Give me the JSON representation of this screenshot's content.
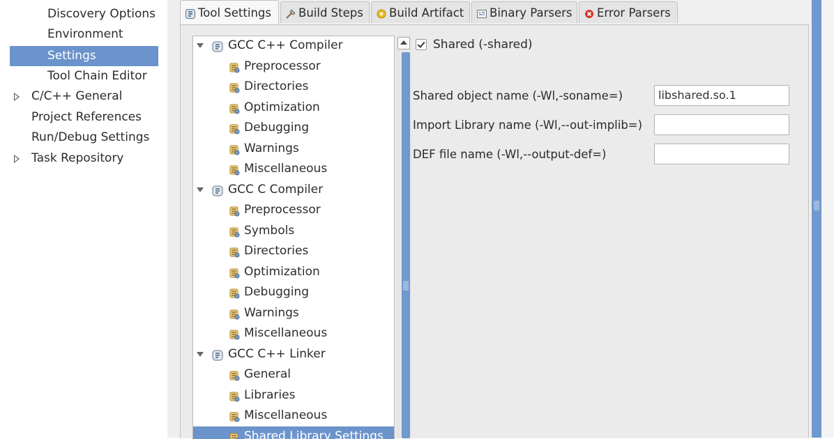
{
  "nav": {
    "items": [
      {
        "label": "Discovery Options",
        "level": 1,
        "selected": false,
        "expandable": false
      },
      {
        "label": "Environment",
        "level": 1,
        "selected": false,
        "expandable": false
      },
      {
        "label": "Settings",
        "level": 1,
        "selected": true,
        "expandable": false
      },
      {
        "label": "Tool Chain Editor",
        "level": 1,
        "selected": false,
        "expandable": false
      },
      {
        "label": "C/C++ General",
        "level": 0,
        "selected": false,
        "expandable": true
      },
      {
        "label": "Project References",
        "level": 0,
        "selected": false,
        "expandable": false
      },
      {
        "label": "Run/Debug Settings",
        "level": 0,
        "selected": false,
        "expandable": false
      },
      {
        "label": "Task Repository",
        "level": 0,
        "selected": false,
        "expandable": true
      }
    ]
  },
  "tabs": [
    {
      "label": "Tool Settings",
      "icon": "tool-settings-icon",
      "active": true
    },
    {
      "label": "Build Steps",
      "icon": "build-steps-icon",
      "active": false
    },
    {
      "label": "Build Artifact",
      "icon": "build-artifact-icon",
      "active": false
    },
    {
      "label": "Binary Parsers",
      "icon": "binary-parsers-icon",
      "active": false
    },
    {
      "label": "Error Parsers",
      "icon": "error-parsers-icon",
      "active": false
    }
  ],
  "tree": {
    "items": [
      {
        "label": "GCC C++ Compiler",
        "level": 0,
        "icon": "tool-icon",
        "expanded": true
      },
      {
        "label": "Preprocessor",
        "level": 1,
        "icon": "option-category-icon"
      },
      {
        "label": "Directories",
        "level": 1,
        "icon": "option-category-icon"
      },
      {
        "label": "Optimization",
        "level": 1,
        "icon": "option-category-icon"
      },
      {
        "label": "Debugging",
        "level": 1,
        "icon": "option-category-icon"
      },
      {
        "label": "Warnings",
        "level": 1,
        "icon": "option-category-icon"
      },
      {
        "label": "Miscellaneous",
        "level": 1,
        "icon": "option-category-icon"
      },
      {
        "label": "GCC C Compiler",
        "level": 0,
        "icon": "tool-icon",
        "expanded": true
      },
      {
        "label": "Preprocessor",
        "level": 1,
        "icon": "option-category-icon"
      },
      {
        "label": "Symbols",
        "level": 1,
        "icon": "option-category-icon"
      },
      {
        "label": "Directories",
        "level": 1,
        "icon": "option-category-icon"
      },
      {
        "label": "Optimization",
        "level": 1,
        "icon": "option-category-icon"
      },
      {
        "label": "Debugging",
        "level": 1,
        "icon": "option-category-icon"
      },
      {
        "label": "Warnings",
        "level": 1,
        "icon": "option-category-icon"
      },
      {
        "label": "Miscellaneous",
        "level": 1,
        "icon": "option-category-icon"
      },
      {
        "label": "GCC C++ Linker",
        "level": 0,
        "icon": "tool-icon",
        "expanded": true
      },
      {
        "label": "General",
        "level": 1,
        "icon": "option-category-icon"
      },
      {
        "label": "Libraries",
        "level": 1,
        "icon": "option-category-icon"
      },
      {
        "label": "Miscellaneous",
        "level": 1,
        "icon": "option-category-icon"
      },
      {
        "label": "Shared Library Settings",
        "level": 1,
        "icon": "option-category-icon",
        "selected": true
      }
    ]
  },
  "options": {
    "shared": {
      "label": "Shared (-shared)",
      "checked": true
    },
    "fields": [
      {
        "label": "Shared object name (-Wl,-soname=)",
        "value": "libshared.so.1"
      },
      {
        "label": "Import Library name (-Wl,--out-implib=)",
        "value": ""
      },
      {
        "label": "DEF file name (-Wl,--output-def=)",
        "value": ""
      }
    ]
  },
  "colors": {
    "selection": "#6b93cc",
    "scrollbar": "#6f99cf",
    "error_icon": "#d9342b",
    "artifact_icon": "#e8b923"
  }
}
